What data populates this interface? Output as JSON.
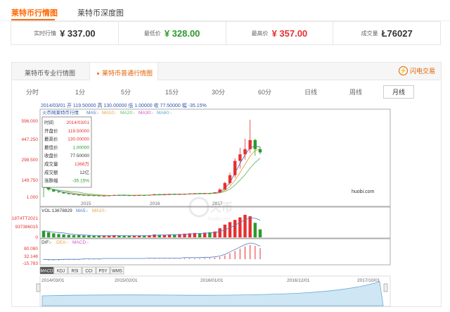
{
  "tabs": {
    "normal": "莱特币行情图",
    "depth": "莱特币深度图"
  },
  "stats": [
    {
      "label": "实时行情",
      "value": "¥ 337.00",
      "color": "#333333"
    },
    {
      "label": "最低价",
      "value": "¥ 328.00",
      "color": "#2a9a2a"
    },
    {
      "label": "最高价",
      "value": "¥ 357.00",
      "color": "#e63030"
    },
    {
      "label": "成交量",
      "value": "Ł76027",
      "color": "#333333"
    }
  ],
  "panel": {
    "tab_pro": "莱特币专业行情图",
    "tab_normal": "莱特币普通行情图",
    "flash_trade": "闪电交易"
  },
  "periods": [
    "分时",
    "1分",
    "5分",
    "15分",
    "30分",
    "60分",
    "日线",
    "周线",
    "月线"
  ],
  "header_line": "2014/03/01 开 119.50000 高 130.00000 低 1.00000 收 77.50000 幅 -35.15%",
  "legend": {
    "name": "火币网莱特币行情",
    "ma5": "MA5:-",
    "ma10": "MA10:-",
    "ma20": "MA20:-",
    "ma30": "MA30:-",
    "ma60": "MA60:-"
  },
  "y_ticks": [
    "596.000",
    "447.250",
    "298.500",
    "149.750",
    "1.000"
  ],
  "x_ticks": [
    "2015",
    "2016",
    "2017"
  ],
  "watermark": "huobi.com",
  "watermark_cn": "火币",
  "watermark_sub": "huobi.com",
  "tooltip": {
    "rows": [
      [
        "时间",
        "2014/03/01"
      ],
      [
        "开盘价",
        "119.50000"
      ],
      [
        "最高价",
        "130.00000"
      ],
      [
        "最低价",
        "1.00000"
      ],
      [
        "收盘价",
        "77.50000"
      ],
      [
        "成交量",
        "1368万"
      ],
      [
        "成交额",
        "12亿"
      ],
      [
        "涨跌幅",
        "-35.15%"
      ]
    ]
  },
  "vol": {
    "legend": "VOL:13678829",
    "ma5": "MA5:-",
    "ma10": "MA10:-",
    "y_ticks": [
      "18T4TT2021",
      "937386015",
      "0"
    ]
  },
  "macd": {
    "legend": "DIF:-",
    "dea": "DEA:-",
    "macd": "MACD:-",
    "y_ticks": [
      "80.080",
      "32.148",
      "-15.783"
    ]
  },
  "indicators": [
    "MACD",
    "KDJ",
    "RSI",
    "CCI",
    "PSY",
    "WMS"
  ],
  "nav_dates": [
    "2014/03/01",
    "2015/02/01",
    "2016/01/01",
    "2016/12/01",
    "2017/10/01"
  ],
  "colors": {
    "accent": "#ff6600",
    "up": "#e63030",
    "down": "#2a9a2a",
    "ma5": "#4a78c8",
    "ma10": "#e8a040",
    "ma20": "#66bb66"
  },
  "chart_data": {
    "type": "candlestick",
    "candles": [
      {
        "o": 119.5,
        "h": 130,
        "l": 1,
        "c": 77.5
      },
      {
        "o": 77,
        "h": 80,
        "l": 50,
        "c": 60
      },
      {
        "o": 60,
        "h": 62,
        "l": 40,
        "c": 45
      },
      {
        "o": 45,
        "h": 50,
        "l": 35,
        "c": 40
      },
      {
        "o": 40,
        "h": 42,
        "l": 28,
        "c": 30
      },
      {
        "o": 30,
        "h": 33,
        "l": 22,
        "c": 25
      },
      {
        "o": 25,
        "h": 27,
        "l": 18,
        "c": 20
      },
      {
        "o": 20,
        "h": 22,
        "l": 16,
        "c": 18
      },
      {
        "o": 18,
        "h": 20,
        "l": 15,
        "c": 16
      },
      {
        "o": 16,
        "h": 18,
        "l": 13,
        "c": 15
      },
      {
        "o": 15,
        "h": 17,
        "l": 12,
        "c": 14
      },
      {
        "o": 14,
        "h": 16,
        "l": 10,
        "c": 11
      },
      {
        "o": 11,
        "h": 14,
        "l": 9,
        "c": 13
      },
      {
        "o": 13,
        "h": 16,
        "l": 12,
        "c": 15
      },
      {
        "o": 15,
        "h": 20,
        "l": 14,
        "c": 18
      },
      {
        "o": 18,
        "h": 20,
        "l": 15,
        "c": 17
      },
      {
        "o": 17,
        "h": 19,
        "l": 14,
        "c": 16
      },
      {
        "o": 16,
        "h": 18,
        "l": 14,
        "c": 15
      },
      {
        "o": 15,
        "h": 17,
        "l": 14,
        "c": 16
      },
      {
        "o": 16,
        "h": 19,
        "l": 15,
        "c": 17
      },
      {
        "o": 17,
        "h": 18,
        "l": 15,
        "c": 16
      },
      {
        "o": 16,
        "h": 20,
        "l": 15,
        "c": 19
      },
      {
        "o": 19,
        "h": 26,
        "l": 18,
        "c": 24
      },
      {
        "o": 24,
        "h": 26,
        "l": 20,
        "c": 22
      },
      {
        "o": 22,
        "h": 25,
        "l": 20,
        "c": 23
      },
      {
        "o": 23,
        "h": 27,
        "l": 22,
        "c": 26
      },
      {
        "o": 26,
        "h": 28,
        "l": 23,
        "c": 24
      },
      {
        "o": 24,
        "h": 27,
        "l": 22,
        "c": 25
      },
      {
        "o": 25,
        "h": 27,
        "l": 24,
        "c": 26
      },
      {
        "o": 26,
        "h": 30,
        "l": 25,
        "c": 29
      },
      {
        "o": 29,
        "h": 33,
        "l": 27,
        "c": 31
      },
      {
        "o": 31,
        "h": 33,
        "l": 28,
        "c": 30
      },
      {
        "o": 30,
        "h": 34,
        "l": 28,
        "c": 32
      },
      {
        "o": 32,
        "h": 34,
        "l": 29,
        "c": 31
      },
      {
        "o": 31,
        "h": 40,
        "l": 30,
        "c": 38
      },
      {
        "o": 38,
        "h": 70,
        "l": 36,
        "c": 60
      },
      {
        "o": 60,
        "h": 120,
        "l": 55,
        "c": 110
      },
      {
        "o": 110,
        "h": 190,
        "l": 95,
        "c": 170
      },
      {
        "o": 170,
        "h": 300,
        "l": 150,
        "c": 280
      },
      {
        "o": 280,
        "h": 380,
        "l": 220,
        "c": 330
      },
      {
        "o": 330,
        "h": 450,
        "l": 290,
        "c": 370
      },
      {
        "o": 370,
        "h": 596,
        "l": 340,
        "c": 440
      },
      {
        "o": 440,
        "h": 450,
        "l": 320,
        "c": 370
      },
      {
        "o": 370,
        "h": 390,
        "l": 330,
        "c": 345
      }
    ],
    "volume": [
      18,
      14,
      11,
      9,
      8,
      7,
      6,
      6,
      5,
      5,
      4,
      4,
      4,
      5,
      6,
      5,
      4,
      4,
      4,
      5,
      5,
      6,
      8,
      7,
      7,
      8,
      7,
      9,
      10,
      11,
      12,
      11,
      13,
      14,
      16,
      25,
      35,
      42,
      48,
      55,
      62,
      58,
      40,
      22
    ],
    "macd": [
      -2,
      -3,
      -3,
      -3,
      -2,
      -2,
      -2,
      -2,
      -1,
      -1,
      -1,
      -1,
      0,
      0,
      0,
      0,
      0,
      0,
      0,
      0,
      0,
      1,
      1,
      1,
      1,
      1,
      1,
      1,
      2,
      2,
      2,
      2,
      3,
      3,
      4,
      6,
      10,
      16,
      22,
      28,
      34,
      38,
      36,
      30
    ],
    "y_range": [
      1,
      596
    ]
  }
}
